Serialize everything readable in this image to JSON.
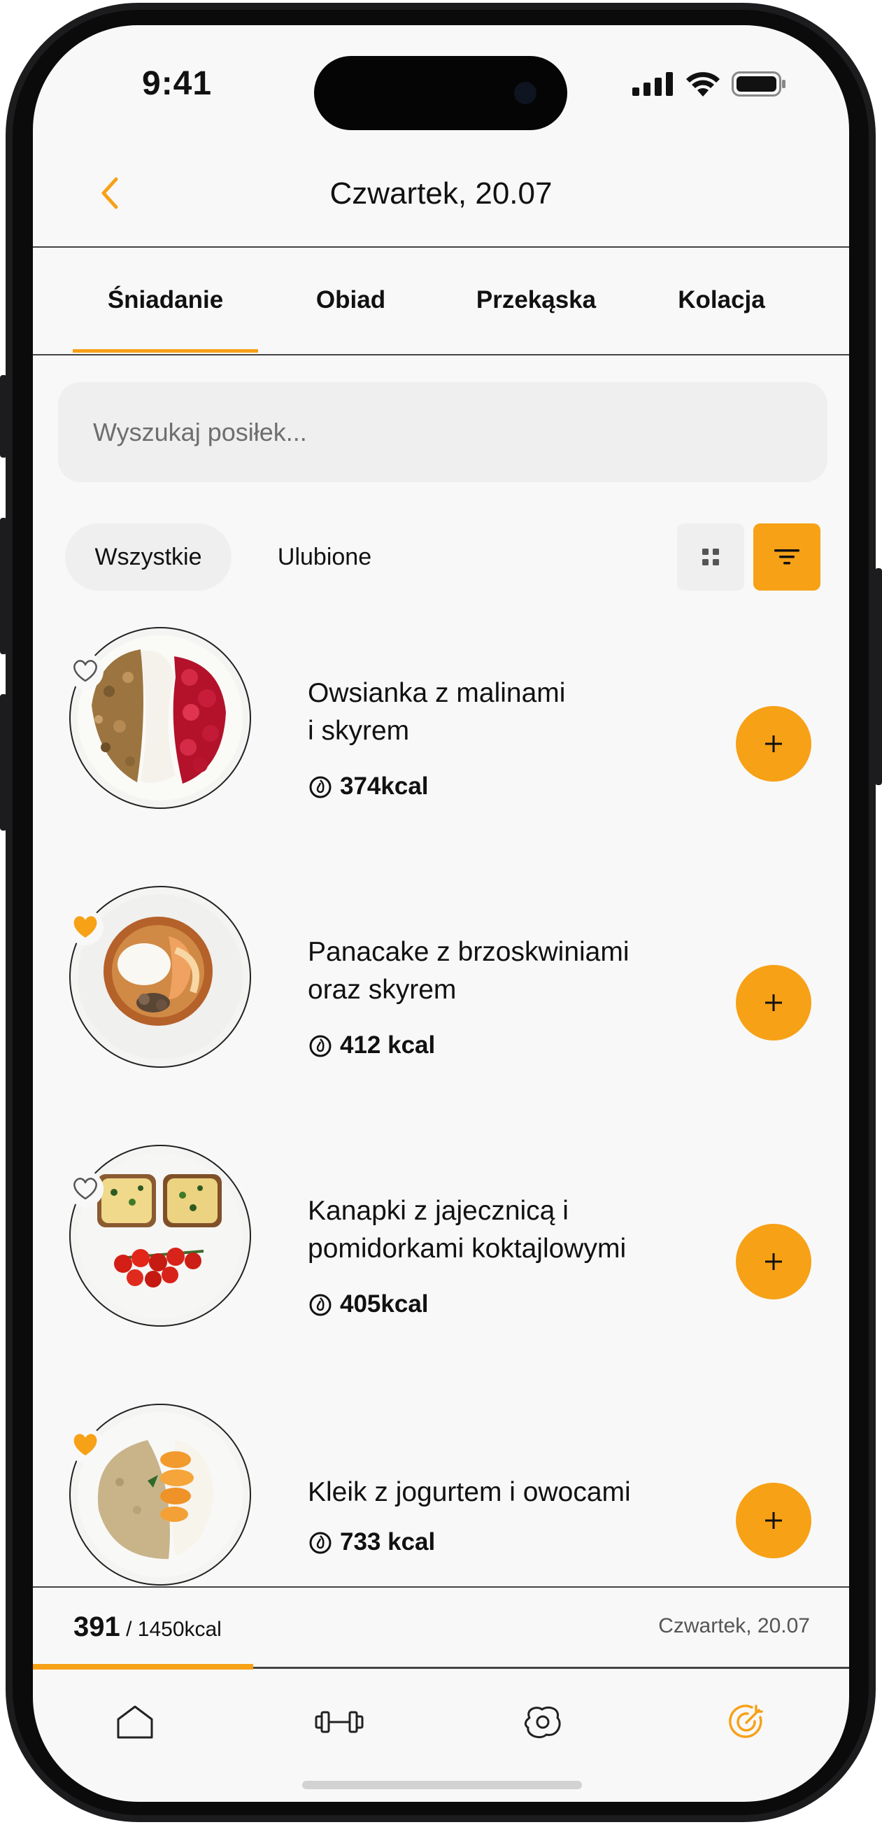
{
  "status_bar": {
    "time": "9:41"
  },
  "header": {
    "title": "Czwartek, 20.07",
    "back_icon": "chevron-left-icon"
  },
  "tabs": [
    {
      "label": "Śniadanie",
      "active": true
    },
    {
      "label": "Obiad",
      "active": false
    },
    {
      "label": "Przekąska",
      "active": false
    },
    {
      "label": "Kolacja",
      "active": false
    }
  ],
  "search": {
    "placeholder": "Wyszukaj posiłek..."
  },
  "filters": {
    "chips": [
      {
        "label": "Wszystkie",
        "active": true
      },
      {
        "label": "Ulubione",
        "active": false
      }
    ],
    "grid_icon": "grid-icon",
    "filter_icon": "filter-icon"
  },
  "meals": [
    {
      "name_line1": "Owsianka z malinami",
      "name_line2": "i skyrem",
      "kcal": "374kcal",
      "favorite": false
    },
    {
      "name_line1": "Panacake z brzoskwiniami",
      "name_line2": "oraz skyrem",
      "kcal": "412 kcal",
      "favorite": true
    },
    {
      "name_line1": "Kanapki z jajecznicą i",
      "name_line2": "pomidorkami koktajlowymi",
      "kcal": "405kcal",
      "favorite": false
    },
    {
      "name_line1": "Kleik z jogurtem i owocami",
      "name_line2": "",
      "kcal": "733 kcal",
      "favorite": true
    }
  ],
  "summary": {
    "consumed": "391",
    "goal": "/ 1450kcal",
    "date": "Czwartek, 20.07",
    "progress_fraction": 0.27
  },
  "nav": [
    "home-icon",
    "dumbbell-icon",
    "egg-icon",
    "target-icon"
  ],
  "colors": {
    "accent": "#f7a117",
    "background": "#f8f8f8",
    "text": "#111111"
  }
}
